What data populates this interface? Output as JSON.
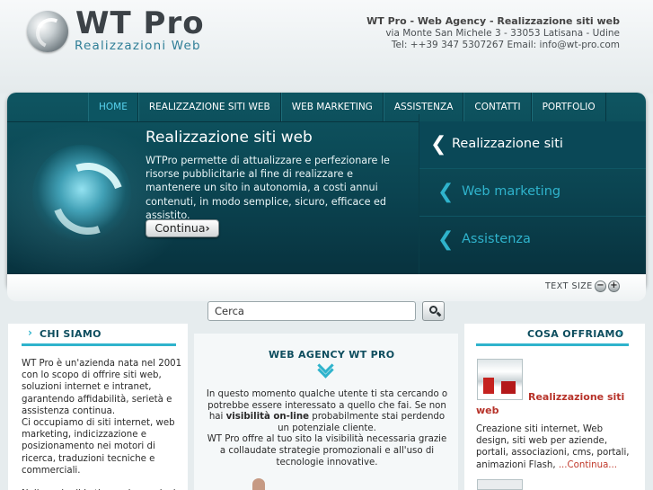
{
  "header": {
    "logo_title": "WT Pro",
    "logo_subtitle": "Realizzazioni Web",
    "company_name": "WT Pro - Web Agency - Realizzazione siti web",
    "address": "via Monte San Michele 3 - 33053 Latisana - Udine",
    "contact": "Tel: ++39 347 5307267 Email: info@wt-pro.com"
  },
  "nav": [
    "HOME",
    "REALIZZAZIONE SITI WEB",
    "WEB MARKETING",
    "ASSISTENZA",
    "CONTATTI",
    "PORTFOLIO"
  ],
  "banner": {
    "title": "Realizzazione siti web",
    "text": "WTPro permette di attualizzare e perfezionare le risorse pubblicitarie al fine di realizzare e mantenere un sito in autonomia, a costi annui contenuti, in modo semplice, sicuro, efficace ed assistito.",
    "button": "Continua",
    "button_arrow": "›"
  },
  "right_panel": [
    {
      "label": "Realizzazione siti",
      "chevron": "❮"
    },
    {
      "label": "Web marketing",
      "chevron": "❮"
    },
    {
      "label": "Assistenza",
      "chevron": "❮"
    }
  ],
  "text_size": {
    "label": "TEXT SIZE",
    "minus": "−",
    "plus": "+"
  },
  "search": {
    "value": "Cerca"
  },
  "chi_siamo": {
    "chevron": "›",
    "title": "CHI SIAMO",
    "text": "WT Pro è un'azienda nata nel 2001 con lo scopo di offrire siti web, soluzioni internet e intranet, garantendo affidabilità, serietà e assistenza continua.\nCi occupiamo di siti internet, web marketing, indicizzazione e posizionamento nei motori di ricerca, traduzioni tecniche e commerciali.\n\nNella sede di Latisana, in provincia"
  },
  "web_agency": {
    "title": "WEB AGENCY WT PRO",
    "text_part1": "In questo momento qualche utente ti sta cercando o potrebbe essere interessato a quello che fai. Se non hai ",
    "text_bold": "visibilità on-line",
    "text_part2": " probabilmente stai perdendo un potenziale cliente.\nWT Pro offre al tuo sito la visibilità necessaria grazie a collaudate strategie promozionali e all'uso di tecnologie innovative."
  },
  "cosa_offriamo": {
    "title": "COSA OFFRIAMO",
    "chevron": "›",
    "item_title": "Realizzazione siti web",
    "item_text": "Creazione siti internet, Web design, siti web per aziende, portali, associazioni, cms, portali, animazioni Flash, ",
    "item_more": "...Continua..."
  },
  "colors": {
    "accent": "#2fb3cc",
    "banner": "#0b4451",
    "offer_title": "#b7332a"
  }
}
